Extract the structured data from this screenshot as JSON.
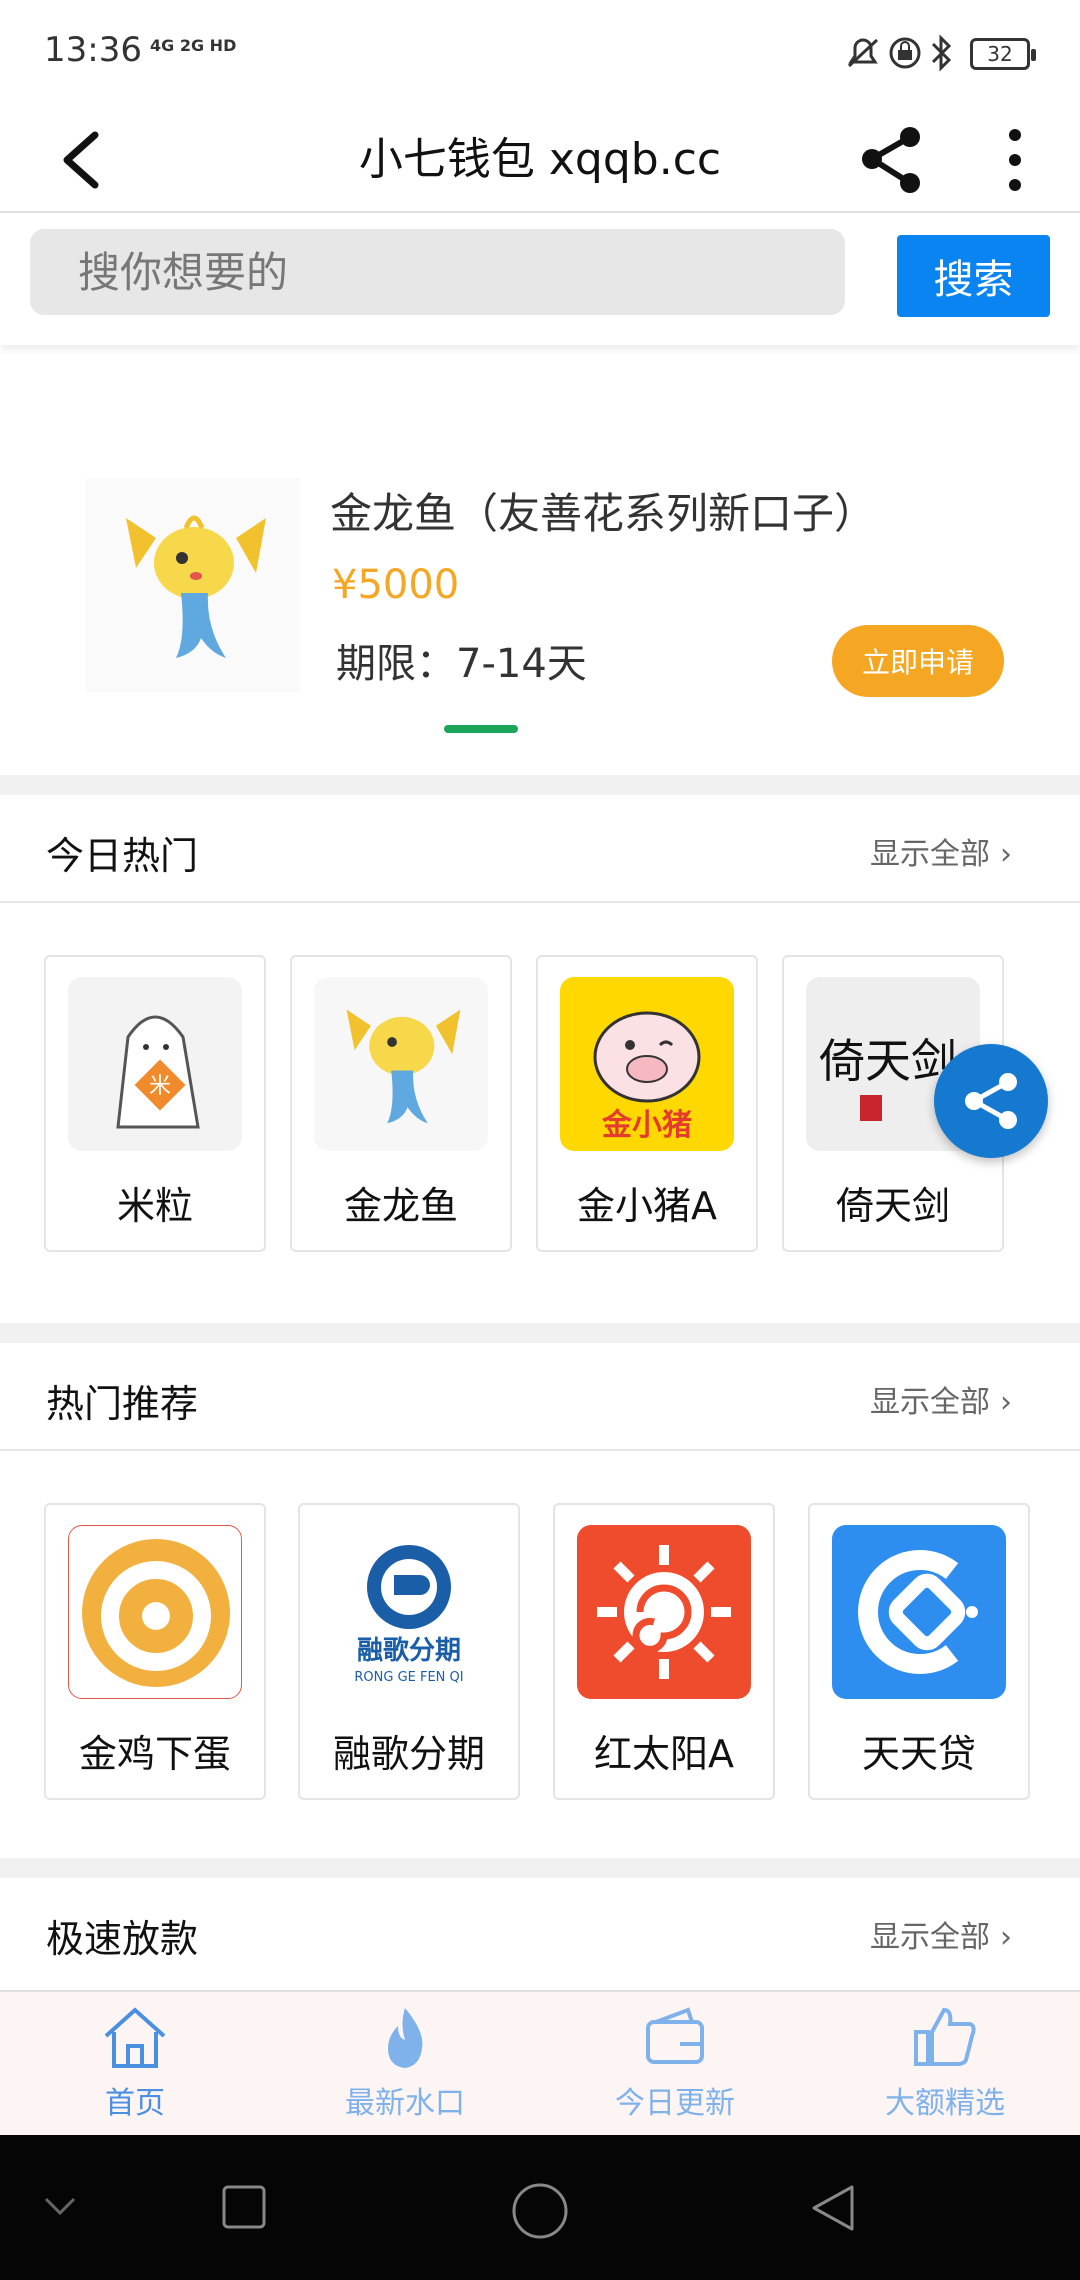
{
  "status_bar": {
    "time": "13:36",
    "network": "4G 2G HD",
    "battery": "32"
  },
  "header": {
    "title": "小七钱包 xqqb.cc"
  },
  "search": {
    "placeholder": "搜你想要的",
    "button": "搜索"
  },
  "banner": {
    "name": "金龙鱼（友善花系列新口子）",
    "price": "¥5000",
    "period": "期限：7-14天",
    "apply": "立即申请"
  },
  "sections": [
    {
      "title": "今日热门",
      "more": "显示全部",
      "items": [
        "米粒",
        "金龙鱼",
        "金小猪A",
        "倚天剑"
      ]
    },
    {
      "title": "热门推荐",
      "more": "显示全部",
      "items": [
        "金鸡下蛋",
        "融歌分期",
        "红太阳A",
        "天天贷"
      ]
    },
    {
      "title": "极速放款",
      "more": "显示全部"
    }
  ],
  "icon_text": {
    "mi": "米",
    "pig": "金小猪",
    "sword": "倚天剑",
    "rongge_cn": "融歌分期",
    "rongge_en": "RONG GE FEN QI"
  },
  "tabs": [
    "首页",
    "最新水口",
    "今日更新",
    "大额精选"
  ],
  "colors": {
    "accent": "#0a84f0",
    "orange": "#f5a623",
    "green": "#1ba55b",
    "tab": "#7fb2ea"
  }
}
